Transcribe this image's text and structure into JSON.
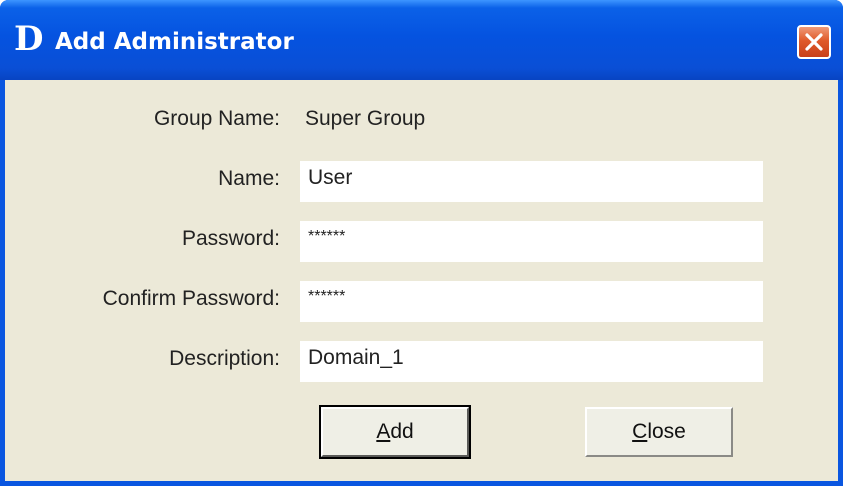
{
  "window": {
    "logo_letter": "D",
    "title": "Add Administrator"
  },
  "form": {
    "group_name_label": "Group Name:",
    "group_name_value": "Super Group",
    "name_label": "Name:",
    "name_value": "User",
    "password_label": "Password:",
    "password_value": "******",
    "confirm_password_label": "Confirm Password:",
    "confirm_password_value": "******",
    "description_label": "Description:",
    "description_value": "Domain_1"
  },
  "buttons": {
    "add_mnemonic": "A",
    "add_rest": "dd",
    "close_mnemonic": "C",
    "close_rest": "lose"
  },
  "icons": {
    "close": "close-x-icon",
    "app": "dlink-d-logo-icon"
  },
  "colors": {
    "titlebar": "#0553e0",
    "client_bg": "#ece9d8",
    "close_button": "#e05a2a",
    "field_bg": "#ffffff"
  }
}
